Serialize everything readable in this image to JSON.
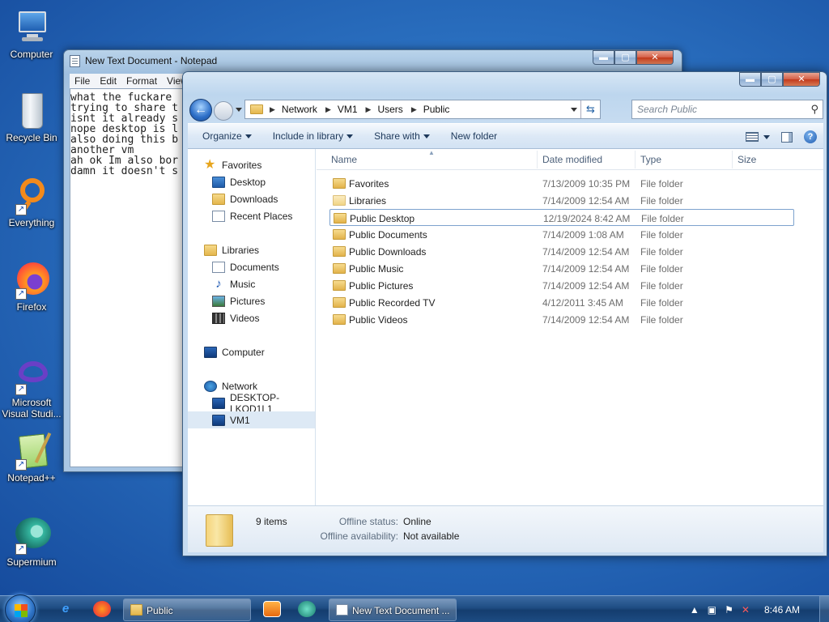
{
  "desktop": {
    "icons": [
      {
        "label": "Computer",
        "icon": "computer-icon"
      },
      {
        "label": "Recycle Bin",
        "icon": "recycle-bin-icon"
      },
      {
        "label": "Everything",
        "icon": "everything-icon"
      },
      {
        "label": "Firefox",
        "icon": "firefox-icon"
      },
      {
        "label": "Microsoft Visual Studi...",
        "icon": "visual-studio-icon"
      },
      {
        "label": "Notepad++",
        "icon": "notepadpp-icon"
      },
      {
        "label": "Supermium",
        "icon": "supermium-icon"
      }
    ]
  },
  "notepad": {
    "title": "New Text Document - Notepad",
    "menu": [
      "File",
      "Edit",
      "Format",
      "View"
    ],
    "text": "what the fuckare\ntrying to share t\nisnt it already s\nnope desktop is l\nalso doing this b\nanother vm\nah ok Im also bor\ndamn it doesn't s"
  },
  "explorer": {
    "nav_back": "←",
    "address": {
      "segments": [
        "Network",
        "VM1",
        "Users",
        "Public"
      ],
      "separator": "▶"
    },
    "search_placeholder": "Search Public",
    "commands": {
      "organize": "Organize",
      "include": "Include in library",
      "share": "Share with",
      "new_folder": "New folder"
    },
    "nav_pane": {
      "favorites": "Favorites",
      "desktop": "Desktop",
      "downloads": "Downloads",
      "recent": "Recent Places",
      "libraries": "Libraries",
      "documents": "Documents",
      "music": "Music",
      "pictures": "Pictures",
      "videos": "Videos",
      "computer": "Computer",
      "network": "Network",
      "desktop_pc": "DESKTOP-LKOD1L1",
      "vm1": "VM1"
    },
    "columns": {
      "name": "Name",
      "date": "Date modified",
      "type": "Type",
      "size": "Size"
    },
    "files": [
      {
        "name": "Favorites",
        "date": "7/13/2009 10:35 PM",
        "type": "File folder"
      },
      {
        "name": "Libraries",
        "date": "7/14/2009 12:54 AM",
        "type": "File folder"
      },
      {
        "name": "Public Desktop",
        "date": "12/19/2024 8:42 AM",
        "type": "File folder"
      },
      {
        "name": "Public Documents",
        "date": "7/14/2009 1:08 AM",
        "type": "File folder"
      },
      {
        "name": "Public Downloads",
        "date": "7/14/2009 12:54 AM",
        "type": "File folder"
      },
      {
        "name": "Public Music",
        "date": "7/14/2009 12:54 AM",
        "type": "File folder"
      },
      {
        "name": "Public Pictures",
        "date": "7/14/2009 12:54 AM",
        "type": "File folder"
      },
      {
        "name": "Public Recorded TV",
        "date": "4/12/2011 3:45 AM",
        "type": "File folder"
      },
      {
        "name": "Public Videos",
        "date": "7/14/2009 12:54 AM",
        "type": "File folder"
      }
    ],
    "details": {
      "count": "9 items",
      "offline_status_label": "Offline status:",
      "offline_status_value": "Online",
      "offline_avail_label": "Offline availability:",
      "offline_avail_value": "Not available"
    }
  },
  "taskbar": {
    "tasks": [
      {
        "label": "Public"
      },
      {
        "label": "New Text Document ..."
      }
    ],
    "clock": "8:46 AM"
  },
  "window_controls": {
    "minimize": "▬",
    "maximize": "▢",
    "close": "✕"
  }
}
